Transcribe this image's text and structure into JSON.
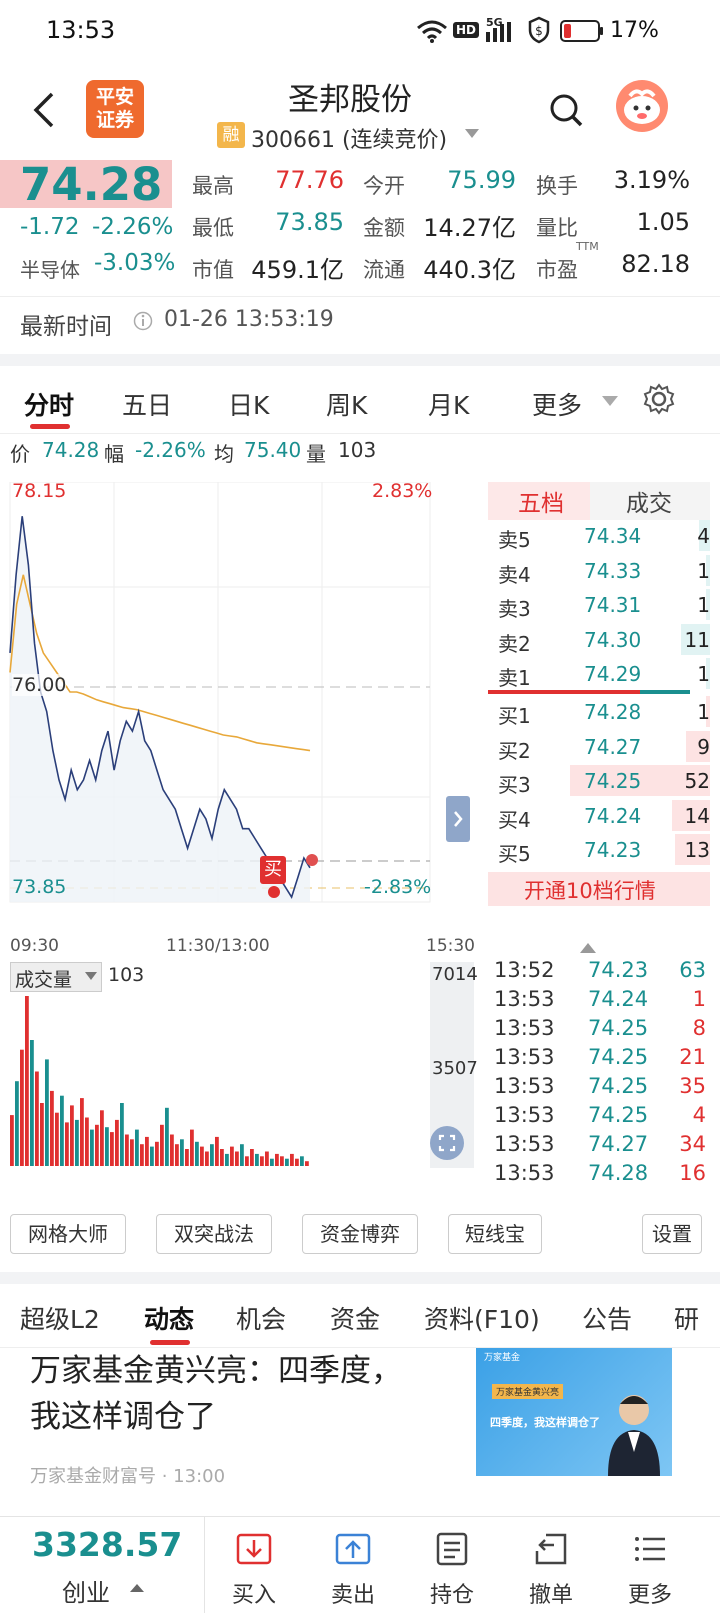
{
  "status_bar": {
    "time": "13:53",
    "battery": "17%",
    "hd": "HD",
    "net": "5G"
  },
  "header": {
    "logo_line1": "平安",
    "logo_line2": "证券",
    "stock_name": "圣邦股份",
    "margin_badge": "融",
    "stock_code": "300661 (连续竞价)"
  },
  "quote": {
    "price": "74.28",
    "change": "-1.72",
    "change_pct": "-2.26%",
    "sector_label": "半导体",
    "sector_pct": "-3.03%",
    "fields": [
      {
        "label": "最高",
        "value": "77.76",
        "color": "red"
      },
      {
        "label": "今开",
        "value": "75.99",
        "color": "teal"
      },
      {
        "label": "换手",
        "value": "3.19%",
        "color": "dark"
      },
      {
        "label": "最低",
        "value": "73.85",
        "color": "teal"
      },
      {
        "label": "金额",
        "value": "14.27亿",
        "color": "dark"
      },
      {
        "label": "量比",
        "value": "1.05",
        "color": "dark"
      },
      {
        "label": "市值",
        "value": "459.1亿",
        "color": "dark"
      },
      {
        "label": "流通",
        "value": "440.3亿",
        "color": "dark"
      },
      {
        "label": "市盈",
        "value": "82.18",
        "color": "dark"
      }
    ],
    "ttm": "TTM"
  },
  "update": {
    "label": "最新时间",
    "datetime": "01-26 13:53:19"
  },
  "chart_tabs": [
    {
      "label": "分时",
      "active": true
    },
    {
      "label": "五日",
      "active": false
    },
    {
      "label": "日K",
      "active": false
    },
    {
      "label": "周K",
      "active": false
    },
    {
      "label": "月K",
      "active": false
    },
    {
      "label": "更多",
      "active": false
    }
  ],
  "info_line": {
    "price_label": "价",
    "price": "74.28",
    "range_label": "幅",
    "range": "-2.26%",
    "avg_label": "均",
    "avg": "75.40",
    "vol_label": "量",
    "vol": "103"
  },
  "chart_labels": {
    "top_price": "78.15",
    "top_pct": "2.83%",
    "mid_price": "76.00",
    "bottom_price": "73.85",
    "bottom_pct": "-2.83%",
    "buy_marker": "买",
    "time_start": "09:30",
    "time_mid": "11:30/13:00",
    "time_end": "15:30"
  },
  "chart_data": {
    "type": "line",
    "ylim": [
      73.85,
      78.15
    ],
    "series": [
      {
        "values": [
          76.4,
          77.2,
          77.8,
          77.3,
          76.5,
          76.0,
          75.8,
          75.4,
          75.1,
          74.9,
          75.2,
          75.0,
          75.1,
          75.3,
          75.1,
          75.4,
          75.6,
          75.2,
          75.5,
          75.7,
          75.6,
          75.8,
          75.5,
          75.4,
          75.2,
          75.0,
          74.9,
          74.8,
          74.6,
          74.4,
          74.6,
          74.8,
          74.7,
          74.5,
          74.8,
          75.0,
          74.9,
          74.8,
          74.6,
          74.6,
          74.5,
          74.4,
          74.3,
          74.2,
          74.1,
          74.0,
          73.9,
          74.1,
          74.3,
          74.2
        ]
      },
      {
        "values": [
          76.2,
          76.9,
          77.2,
          76.9,
          76.6,
          76.4,
          76.3,
          76.2,
          76.1,
          76.0,
          76.0,
          75.98,
          75.95,
          75.92,
          75.9,
          75.88,
          75.86,
          75.84,
          75.83,
          75.82,
          75.8,
          75.78,
          75.76,
          75.74,
          75.72,
          75.7,
          75.68,
          75.66,
          75.64,
          75.62,
          75.6,
          75.58,
          75.56,
          75.55,
          75.54,
          75.52,
          75.5,
          75.48,
          75.47,
          75.46,
          75.45,
          75.44,
          75.43,
          75.42,
          75.41,
          75.4
        ]
      }
    ],
    "volume_ylim": [
      0,
      7014
    ],
    "volume_ticks": [
      "7014",
      "3507"
    ],
    "volume": [
      2100,
      3500,
      4800,
      7014,
      5200,
      3900,
      2600,
      4400,
      3100,
      2200,
      2900,
      1800,
      2500,
      1900,
      2800,
      2000,
      1500,
      1700,
      2300,
      1600,
      1400,
      1900,
      2600,
      1300,
      1100,
      1500,
      900,
      1200,
      800,
      1000,
      1700,
      2400,
      1300,
      900,
      1100,
      700,
      1500,
      1000,
      800,
      600,
      900,
      1200,
      700,
      500,
      800,
      600,
      900,
      400,
      700,
      500,
      400,
      600,
      300,
      500,
      400,
      300,
      500,
      300,
      400,
      200
    ]
  },
  "orderbook": {
    "tab_active": "五档",
    "tab_other": "成交",
    "asks": [
      {
        "label": "卖5",
        "price": "74.34",
        "vol": "4",
        "frac": 0.08
      },
      {
        "label": "卖4",
        "price": "74.33",
        "vol": "1",
        "frac": 0.02
      },
      {
        "label": "卖3",
        "price": "74.31",
        "vol": "1",
        "frac": 0.02
      },
      {
        "label": "卖2",
        "price": "74.30",
        "vol": "11",
        "frac": 0.21
      },
      {
        "label": "卖1",
        "price": "74.29",
        "vol": "1",
        "frac": 0.02
      }
    ],
    "bids": [
      {
        "label": "买1",
        "price": "74.28",
        "vol": "1",
        "frac": 0.02
      },
      {
        "label": "买2",
        "price": "74.27",
        "vol": "9",
        "frac": 0.17
      },
      {
        "label": "买3",
        "price": "74.25",
        "vol": "52",
        "frac": 1.0
      },
      {
        "label": "买4",
        "price": "74.24",
        "vol": "14",
        "frac": 0.27
      },
      {
        "label": "买5",
        "price": "74.23",
        "vol": "13",
        "frac": 0.25
      }
    ],
    "open_l2": "开通10档行情"
  },
  "volume_panel": {
    "label": "成交量",
    "value": "103"
  },
  "trades": [
    {
      "time": "13:52",
      "price": "74.23",
      "vol": "63",
      "side": "sell"
    },
    {
      "time": "13:53",
      "price": "74.24",
      "vol": "1",
      "side": "buy"
    },
    {
      "time": "13:53",
      "price": "74.25",
      "vol": "8",
      "side": "buy"
    },
    {
      "time": "13:53",
      "price": "74.25",
      "vol": "21",
      "side": "buy"
    },
    {
      "time": "13:53",
      "price": "74.25",
      "vol": "35",
      "side": "buy"
    },
    {
      "time": "13:53",
      "price": "74.25",
      "vol": "4",
      "side": "buy"
    },
    {
      "time": "13:53",
      "price": "74.27",
      "vol": "34",
      "side": "buy"
    },
    {
      "time": "13:53",
      "price": "74.28",
      "vol": "16",
      "side": "buy"
    }
  ],
  "tools": [
    "网格大师",
    "双突战法",
    "资金博弈",
    "短线宝",
    "设置"
  ],
  "sub_tabs": [
    {
      "label": "超级L2",
      "active": false
    },
    {
      "label": "动态",
      "active": true
    },
    {
      "label": "机会",
      "active": false
    },
    {
      "label": "资金",
      "active": false
    },
    {
      "label": "资料(F10)",
      "active": false
    },
    {
      "label": "公告",
      "active": false
    },
    {
      "label": "研",
      "active": false
    }
  ],
  "news": {
    "title_line1": "万家基金黄兴亮：四季度，",
    "title_line2": "我这样调仓了",
    "thumb_tag": "万家基金黄兴亮",
    "thumb_title": "四季度，我这样调仓了",
    "thumb_brand": "万家基金",
    "meta": "万家基金财富号 · 13:00"
  },
  "bottom_nav": {
    "index_value": "3328.57",
    "index_name": "创业",
    "items": [
      {
        "label": "买入",
        "icon": "buy-icon"
      },
      {
        "label": "卖出",
        "icon": "sell-icon"
      },
      {
        "label": "持仓",
        "icon": "holdings-icon"
      },
      {
        "label": "撤单",
        "icon": "cancel-order-icon"
      },
      {
        "label": "更多",
        "icon": "more-menu-icon"
      }
    ]
  },
  "colors": {
    "red": "#e03030",
    "teal": "#1a8f8f",
    "price_bg": "#f6c6c6",
    "avg_line": "#e8a83a",
    "price_line": "#2b3f7a"
  }
}
